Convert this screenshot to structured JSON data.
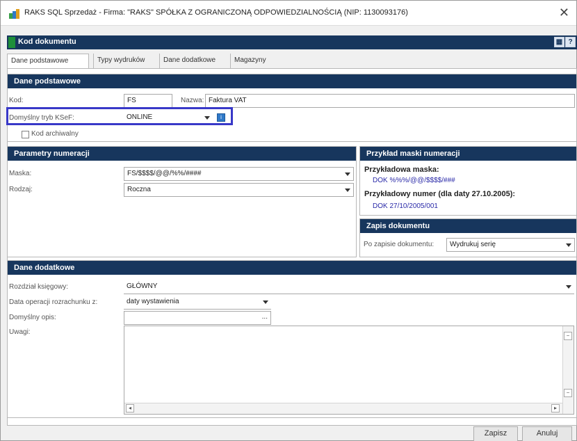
{
  "window": {
    "title": "RAKS SQL Sprzedaż - Firma: \"RAKS\" SPÓŁKA Z OGRANICZONĄ ODPOWIEDZIALNOŚCIĄ (NIP: 1130093176)",
    "close_label": "✕"
  },
  "header": {
    "title": "Kod dokumentu",
    "btn1": "▦",
    "btn2": "?"
  },
  "tabs": [
    "Dane podstawowe",
    "Typy wydruków",
    "Dane dodatkowe",
    "Magazyny"
  ],
  "basic": {
    "heading": "Dane podstawowe",
    "kod_label": "Kod:",
    "kod_value": "FS",
    "nazwa_label": "Nazwa:",
    "nazwa_value": "Faktura VAT",
    "ksef_label": "Domyślny tryb KSeF:",
    "ksef_value": "ONLINE",
    "archive_label": "Kod archiwalny"
  },
  "numbering": {
    "heading": "Parametry numeracji",
    "maska_label": "Maska:",
    "maska_value": "FS/$$$$/@@/%%/####",
    "rodzaj_label": "Rodzaj:",
    "rodzaj_value": "Roczna"
  },
  "example": {
    "heading": "Przykład maski numeracji",
    "mask_title": "Przykładowa maska:",
    "mask_value": "DOK %%%/@@/$$$$/###",
    "number_title": "Przykładowy numer (dla daty 27.10.2005):",
    "number_value": "DOK 27/10/2005/001"
  },
  "save": {
    "heading": "Zapis dokumentu",
    "label": "Po zapisie dokumentu:",
    "value": "Wydrukuj serię"
  },
  "additional": {
    "heading": "Dane dodatkowe",
    "rozdzial_label": "Rozdział księgowy:",
    "rozdzial_value": "GŁÓWNY",
    "data_label": "Data operacji rozrachunku z:",
    "data_value": "daty wystawienia",
    "opis_label": "Domyślny opis:",
    "opis_ellipsis": "...",
    "uwagi_label": "Uwagi:"
  },
  "buttons": {
    "save": "Zapisz",
    "cancel": "Anuluj"
  },
  "colors": {
    "header_bg": "#17365d",
    "highlight": "#3838c8",
    "link": "#2a2aa8",
    "accent_green": "#1e8f3a"
  }
}
